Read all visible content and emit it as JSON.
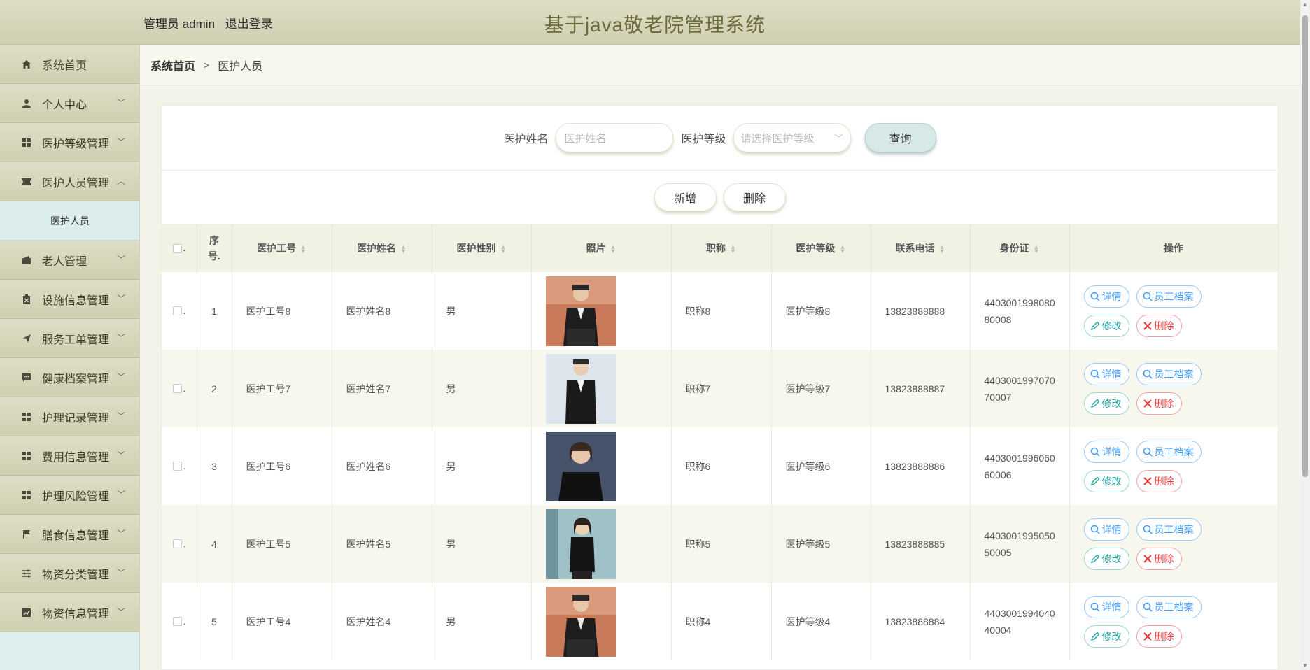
{
  "header": {
    "user_label": "管理员 admin",
    "logout": "退出登录",
    "title": "基于java敬老院管理系统"
  },
  "sidebar": {
    "items": [
      {
        "label": "系统首页",
        "icon": "home-icon"
      },
      {
        "label": "个人中心",
        "icon": "user-icon"
      },
      {
        "label": "医护等级管理",
        "icon": "grid-icon"
      },
      {
        "label": "医护人员管理",
        "icon": "ticket-icon",
        "expanded": true
      },
      {
        "label": "老人管理",
        "icon": "wallet-icon"
      },
      {
        "label": "设施信息管理",
        "icon": "clipboard-icon"
      },
      {
        "label": "服务工单管理",
        "icon": "send-icon"
      },
      {
        "label": "健康档案管理",
        "icon": "chat-icon"
      },
      {
        "label": "护理记录管理",
        "icon": "grid-icon"
      },
      {
        "label": "费用信息管理",
        "icon": "grid-icon"
      },
      {
        "label": "护理风险管理",
        "icon": "grid-icon"
      },
      {
        "label": "膳食信息管理",
        "icon": "flag-icon"
      },
      {
        "label": "物资分类管理",
        "icon": "sliders-icon"
      },
      {
        "label": "物资信息管理",
        "icon": "chart-icon"
      }
    ],
    "subitem": "医护人员"
  },
  "breadcrumb": {
    "home": "系统首页",
    "separator": ">",
    "current": "医护人员"
  },
  "search": {
    "name_label": "医护姓名",
    "name_placeholder": "医护姓名",
    "level_label": "医护等级",
    "level_placeholder": "请选择医护等级",
    "query_button": "查询"
  },
  "actions": {
    "add": "新增",
    "delete": "删除"
  },
  "table": {
    "headers": {
      "seq": "序号.",
      "staff_no": "医护工号",
      "name": "医护姓名",
      "gender": "医护性别",
      "photo": "照片",
      "title": "职称",
      "level": "医护等级",
      "phone": "联系电话",
      "idcard": "身份证",
      "ops": "操作"
    },
    "ops_labels": {
      "detail": "详情",
      "archive": "员工档案",
      "edit": "修改",
      "delete": "删除"
    },
    "rows": [
      {
        "seq": "1",
        "staff_no": "医护工号8",
        "name": "医护姓名8",
        "gender": "男",
        "title": "职称8",
        "level": "医护等级8",
        "phone": "13823888888",
        "idcard": "440300199808080008"
      },
      {
        "seq": "2",
        "staff_no": "医护工号7",
        "name": "医护姓名7",
        "gender": "男",
        "title": "职称7",
        "level": "医护等级7",
        "phone": "13823888887",
        "idcard": "440300199707070007"
      },
      {
        "seq": "3",
        "staff_no": "医护工号6",
        "name": "医护姓名6",
        "gender": "男",
        "title": "职称6",
        "level": "医护等级6",
        "phone": "13823888886",
        "idcard": "440300199606060006"
      },
      {
        "seq": "4",
        "staff_no": "医护工号5",
        "name": "医护姓名5",
        "gender": "男",
        "title": "职称5",
        "level": "医护等级5",
        "phone": "13823888885",
        "idcard": "440300199505050005"
      },
      {
        "seq": "5",
        "staff_no": "医护工号4",
        "name": "医护姓名4",
        "gender": "男",
        "title": "职称4",
        "level": "医护等级4",
        "phone": "13823888884",
        "idcard": "440300199404040004"
      }
    ]
  },
  "colors": {
    "header_bg": "#d6d6bc",
    "title_color": "#6e6a3c",
    "query_bg": "#d6e9e8",
    "link_blue": "#409eff",
    "edit_teal": "#1fa2a0",
    "delete_red": "#e83b3b"
  }
}
